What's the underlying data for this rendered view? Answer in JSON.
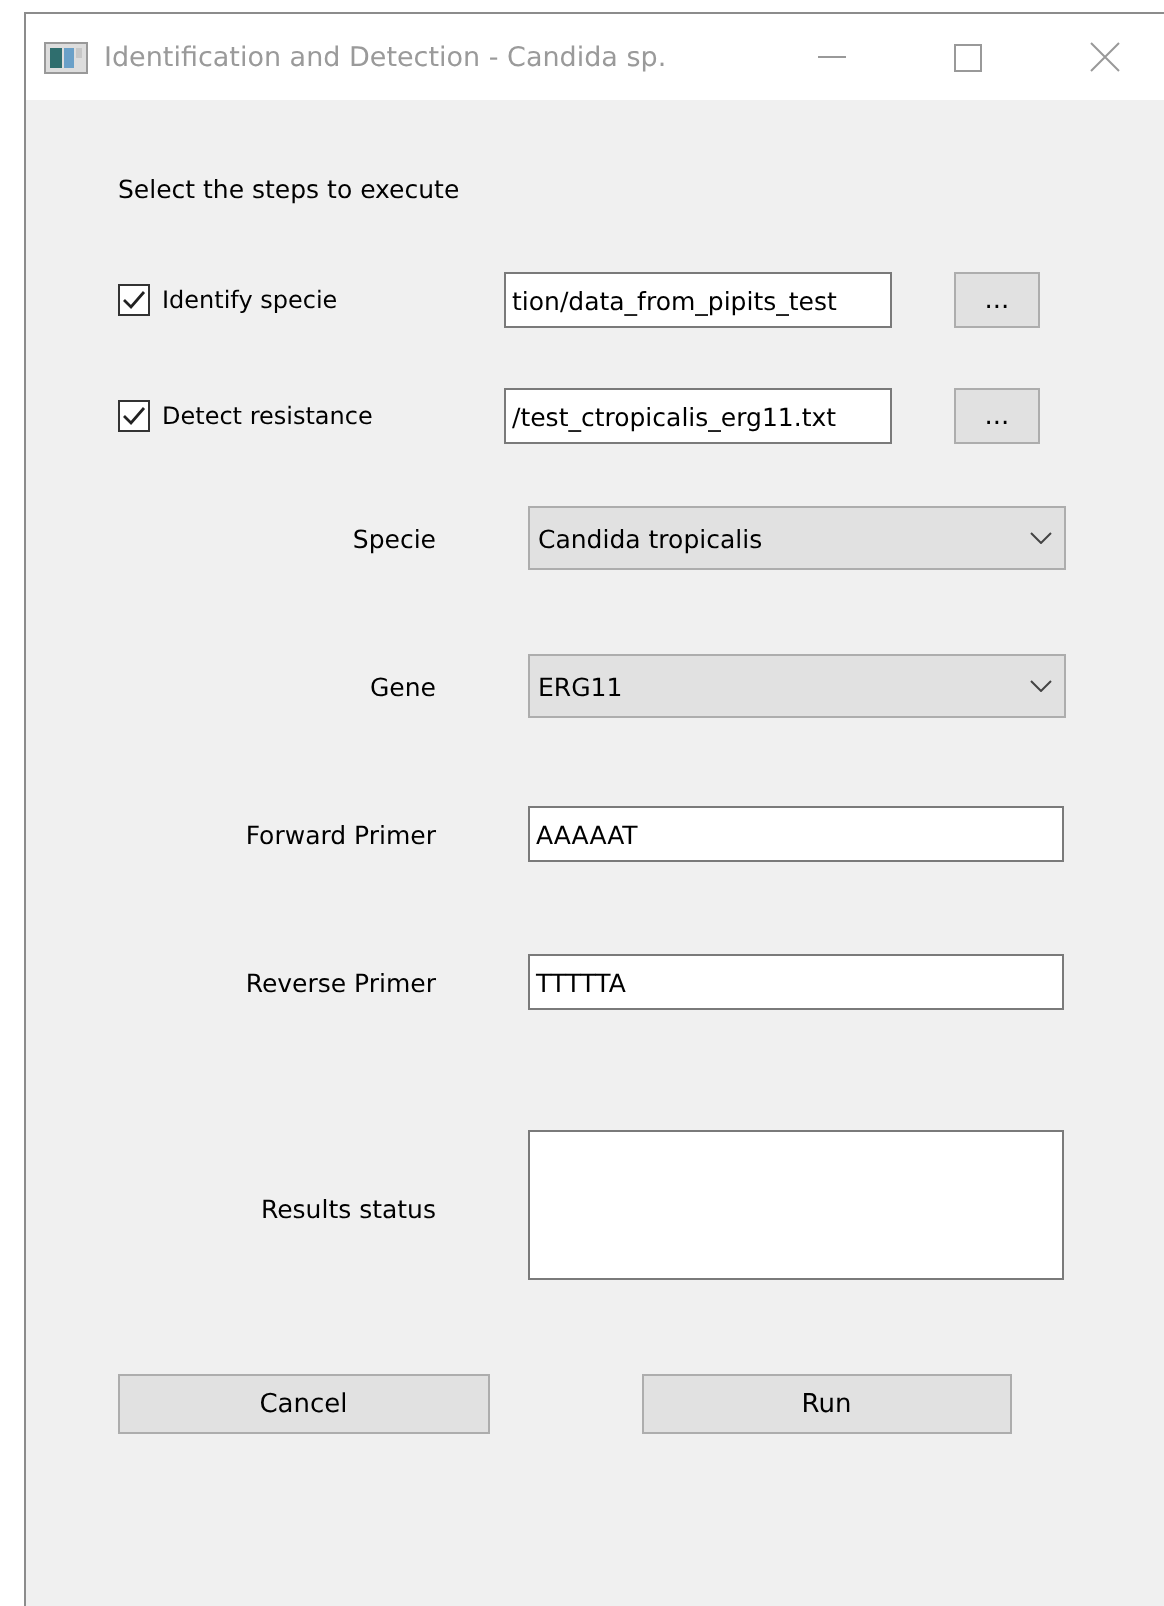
{
  "window": {
    "title": "Identification and Detection - Candida sp."
  },
  "instruction": "Select the steps to execute",
  "steps": [
    {
      "label": "Identify specie",
      "checked": true,
      "path": "tion/data_from_pipits_test",
      "browse": "..."
    },
    {
      "label": "Detect resistance",
      "checked": true,
      "path": "/test_ctropicalis_erg11.txt",
      "browse": "..."
    }
  ],
  "specie": {
    "label": "Specie",
    "value": "Candida tropicalis"
  },
  "gene": {
    "label": "Gene",
    "value": "ERG11"
  },
  "forward_primer": {
    "label": "Forward Primer",
    "value": "AAAAAT"
  },
  "reverse_primer": {
    "label": "Reverse Primer",
    "value": "TTTTTA"
  },
  "results_status": {
    "label": "Results status"
  },
  "buttons": [
    "Cancel",
    "Run"
  ]
}
